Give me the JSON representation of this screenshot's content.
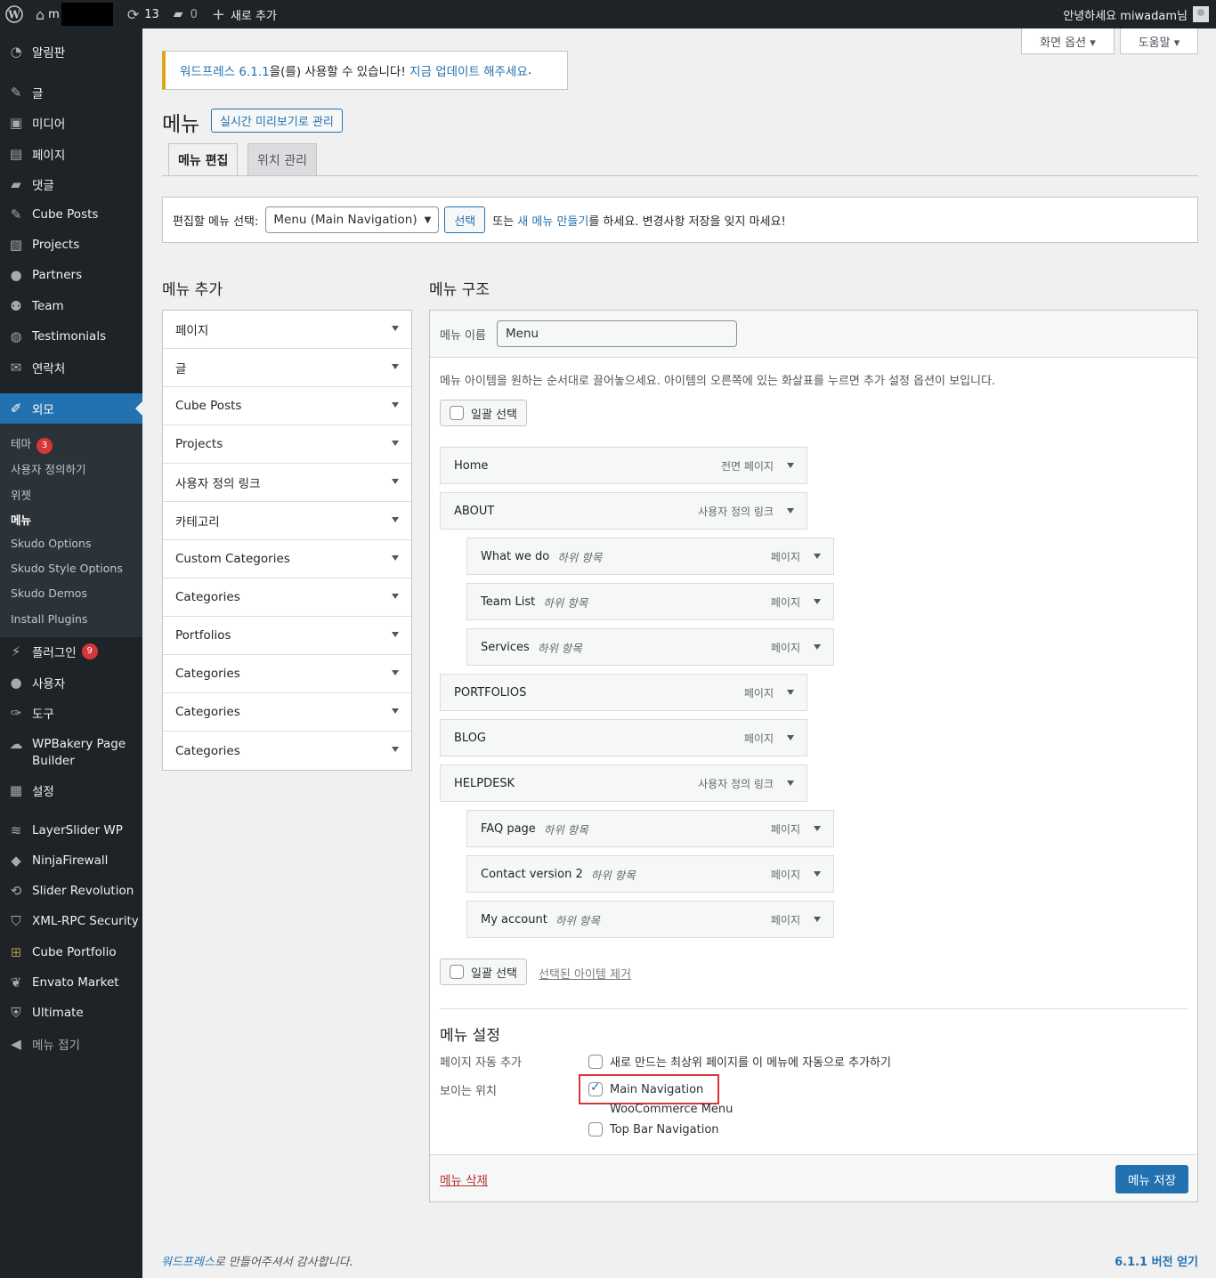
{
  "adminbar": {
    "site_letter": "m",
    "updates_count": "13",
    "comments_count": "0",
    "new_label": "새로 추가",
    "greeting": "안녕하세요 miwadam님"
  },
  "sidebar": {
    "dashboard": "알림판",
    "posts": "글",
    "media": "미디어",
    "pages": "페이지",
    "comments": "댓글",
    "cube_posts": "Cube Posts",
    "projects": "Projects",
    "partners": "Partners",
    "team": "Team",
    "testimonials": "Testimonials",
    "contact": "연락처",
    "appearance": "외모",
    "submenu": {
      "themes": "테마",
      "themes_badge": "3",
      "customize": "사용자 정의하기",
      "widgets": "위젯",
      "menus": "메뉴",
      "skudo_options": "Skudo Options",
      "skudo_style": "Skudo Style Options",
      "skudo_demos": "Skudo Demos",
      "install_plugins": "Install Plugins"
    },
    "plugins": "플러그인",
    "plugins_badge": "9",
    "users": "사용자",
    "tools": "도구",
    "wpbakery_line1": "WPBakery Page",
    "wpbakery_line2": "Builder",
    "settings": "설정",
    "layerslider": "LayerSlider WP",
    "ninjafirewall": "NinjaFirewall",
    "slider_revolution": "Slider Revolution",
    "xmlrpc": "XML-RPC Security",
    "cube_portfolio": "Cube Portfolio",
    "envato": "Envato Market",
    "ultimate": "Ultimate",
    "collapse": "메뉴 접기"
  },
  "screen_options": "화면 옵션 ▾",
  "help": "도움말 ▾",
  "notice": {
    "link1": "워드프레스 6.1.1",
    "text": "을(를) 사용할 수 있습니다! ",
    "link2": "지금 업데이트 해주세요",
    "end": "."
  },
  "page": {
    "title": "메뉴",
    "live_preview": "실시간 미리보기로 관리",
    "tab_edit": "메뉴 편집",
    "tab_locations": "위치 관리"
  },
  "manage": {
    "label": "편집할 메뉴 선택:",
    "selected": "Menu (Main Navigation)",
    "select_btn": "선택",
    "or_text": "또는 ",
    "create_link": "새 메뉴 만들기",
    "rest_text": "를 하세요. 변경사항 저장을 잊지 마세요!"
  },
  "add_menu": {
    "title": "메뉴 추가",
    "items": [
      "페이지",
      "글",
      "Cube Posts",
      "Projects",
      "사용자 정의 링크",
      "카테고리",
      "Custom Categories",
      "Categories",
      "Portfolios",
      "Categories",
      "Categories",
      "Categories"
    ]
  },
  "structure": {
    "title": "메뉴 구조",
    "name_label": "메뉴 이름",
    "name_value": "Menu",
    "instructions": "메뉴 아이템을 원하는 순서대로 끌어놓으세요. 아이템의 오른쪽에 있는 화살표를 누르면 추가 설정 옵션이 보입니다.",
    "bulk_select": "일괄 선택",
    "sub_tag": "하위 항목",
    "items": [
      {
        "title": "Home",
        "type": "전면 페이지"
      },
      {
        "title": "ABOUT",
        "type": "사용자 정의 링크"
      },
      {
        "title": "What we do",
        "type": "페이지"
      },
      {
        "title": "Team List",
        "type": "페이지"
      },
      {
        "title": "Services",
        "type": "페이지"
      },
      {
        "title": "PORTFOLIOS",
        "type": "페이지"
      },
      {
        "title": "BLOG",
        "type": "페이지"
      },
      {
        "title": "HELPDESK",
        "type": "사용자 정의 링크"
      },
      {
        "title": "FAQ page",
        "type": "페이지"
      },
      {
        "title": "Contact version 2",
        "type": "페이지"
      },
      {
        "title": "My account",
        "type": "페이지"
      }
    ],
    "remove_selected": "선택된 아이템 제거"
  },
  "settings": {
    "title": "메뉴 설정",
    "auto_add_label": "페이지 자동 추가",
    "auto_add_option": "새로 만드는 최상위 페이지를 이 메뉴에 자동으로 추가하기",
    "locations_label": "보이는 위치",
    "loc_main": "Main Navigation",
    "loc_woo": "WooCommerce Menu",
    "loc_topbar": "Top Bar Navigation",
    "delete": "메뉴 삭제",
    "save": "메뉴 저장"
  },
  "footer": {
    "thanks_link": "워드프레스",
    "thanks_rest": "로 만들어주셔서 감사합니다.",
    "version": "6.1.1 버전 얻기"
  }
}
